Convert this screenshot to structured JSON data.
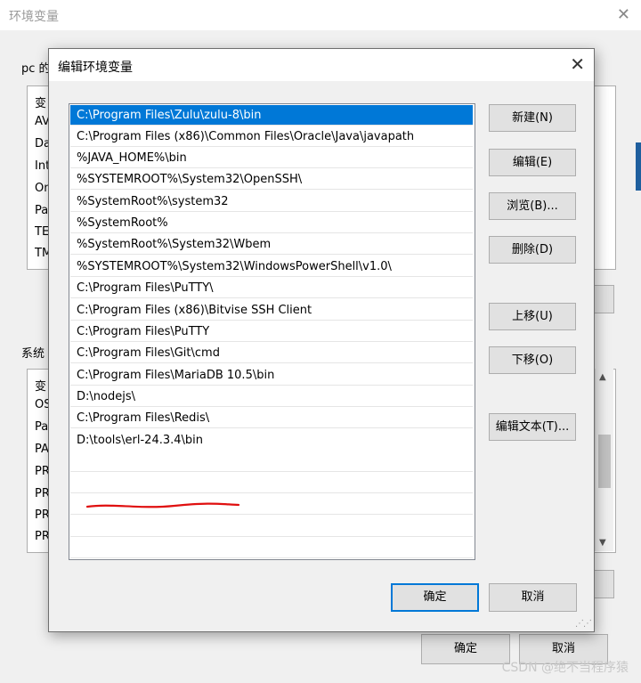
{
  "background_window": {
    "title": "环境变量",
    "user_section_label": "pc 的",
    "user_rows": [
      "变",
      "AV",
      "Da",
      "Int",
      "On",
      "Pa",
      "TE",
      "TM"
    ],
    "system_section_label": "系统",
    "system_rows": [
      "变",
      "OS",
      "Pa",
      "PA",
      "PR",
      "PR",
      "PR",
      "PR"
    ],
    "ok_label": "确定",
    "cancel_label": "取消"
  },
  "dialog": {
    "title": "编辑环境变量",
    "paths": [
      "C:\\Program Files\\Zulu\\zulu-8\\bin",
      "C:\\Program Files (x86)\\Common Files\\Oracle\\Java\\javapath",
      "%JAVA_HOME%\\bin",
      "%SYSTEMROOT%\\System32\\OpenSSH\\",
      "%SystemRoot%\\system32",
      "%SystemRoot%",
      "%SystemRoot%\\System32\\Wbem",
      "%SYSTEMROOT%\\System32\\WindowsPowerShell\\v1.0\\",
      "C:\\Program Files\\PuTTY\\",
      "C:\\Program Files (x86)\\Bitvise SSH Client",
      "C:\\Program Files\\PuTTY",
      "C:\\Program Files\\Git\\cmd",
      "C:\\Program Files\\MariaDB 10.5\\bin",
      "D:\\nodejs\\",
      "C:\\Program Files\\Redis\\",
      "D:\\tools\\erl-24.3.4\\bin"
    ],
    "selected_index": 0,
    "buttons": {
      "new": "新建(N)",
      "edit": "编辑(E)",
      "browse": "浏览(B)...",
      "delete": "删除(D)",
      "move_up": "上移(U)",
      "move_down": "下移(O)",
      "edit_text": "编辑文本(T)...",
      "ok": "确定",
      "cancel": "取消"
    }
  },
  "watermark": "CSDN @绝不当程序猿",
  "colors": {
    "selection": "#0078d7",
    "annotation": "#e01010"
  }
}
